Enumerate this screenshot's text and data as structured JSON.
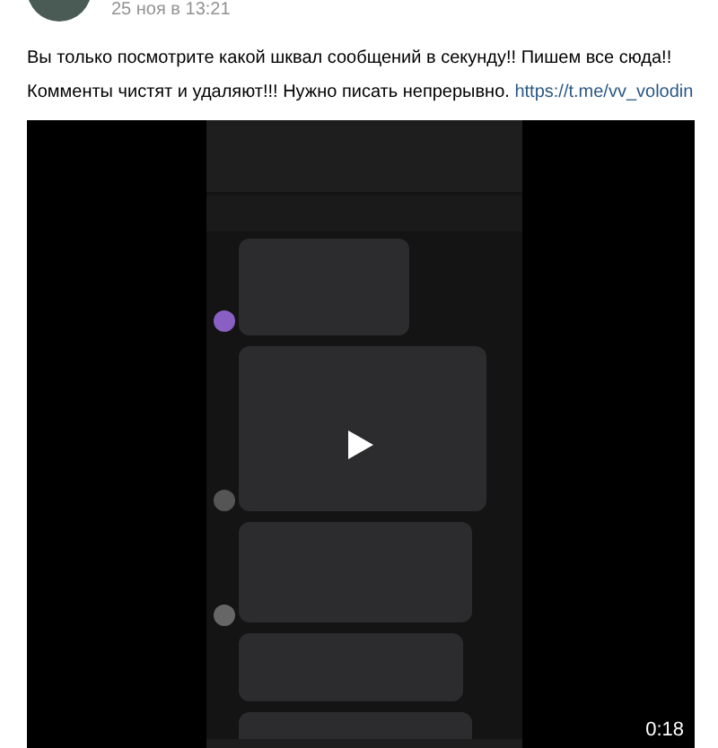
{
  "post": {
    "date": "25 ноя в 13:21",
    "text": "Вы только посмотрите какой шквал сообщений в секунду!! Пишем все сюда!! Комменты чистят и удаляют!!! Нужно писать непрерывно.",
    "link": "https://t.me/vv_volodin",
    "video": {
      "duration": "0:18"
    }
  }
}
